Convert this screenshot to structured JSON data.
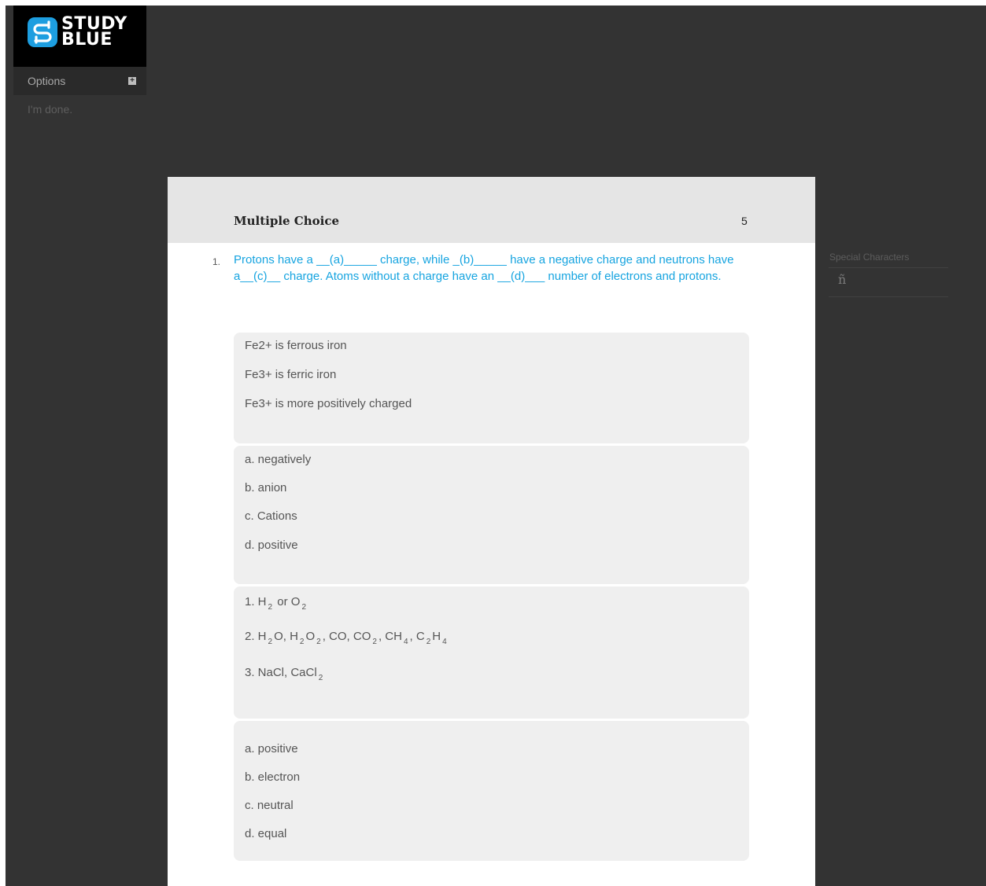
{
  "logo": {
    "line1": "STUDY",
    "line2": "BLUE",
    "icon": "studyblue-logo-icon"
  },
  "sidebar": {
    "options_label": "Options",
    "options_icon": "plus-square-icon",
    "done_label": "I'm done."
  },
  "card": {
    "title": "Multiple Choice",
    "count": "5",
    "question_number": "1.",
    "question_text": "Protons have a __(a)_____ charge, while _(b)_____ have a negative charge and neutrons have a__(c)__ charge. Atoms without a charge have an __(d)___ number of electrons and protons.",
    "blocks": [
      {
        "lines": [
          "Fe2+ is ferrous iron",
          "Fe3+ is ferric iron",
          "Fe3+ is more positively charged"
        ]
      },
      {
        "lines": [
          "a. negatively",
          "b. anion",
          "c. Cations",
          "d. positive"
        ]
      },
      {
        "formulas": {
          "line1_prefix": "1. H",
          "line1_sub1": "2",
          "line1_mid": "or O",
          "line1_sub2": "2",
          "line2_prefix": "2. H",
          "line2_s1": "2",
          "line2_t1": "O, H",
          "line2_s2": "2",
          "line2_t2": "O",
          "line2_s3": "2",
          "line2_t3": ", CO, CO",
          "line2_s4": "2",
          "line2_t4": ", CH",
          "line2_s5": "4",
          "line2_t5": ", C",
          "line2_s6": "2",
          "line2_t6": "H",
          "line2_s7": "4",
          "line3_prefix": "3. NaCl, CaCl",
          "line3_sub": "2"
        }
      },
      {
        "lines": [
          "a. positive",
          "b. electron",
          "c. neutral",
          "d. equal"
        ]
      }
    ]
  },
  "special_characters": {
    "label": "Special Characters",
    "chars": [
      "ñ"
    ]
  },
  "colors": {
    "background": "#333333",
    "question_text": "#16a4e0",
    "card_header": "#e5e5e5",
    "answer_block": "#efefef"
  }
}
